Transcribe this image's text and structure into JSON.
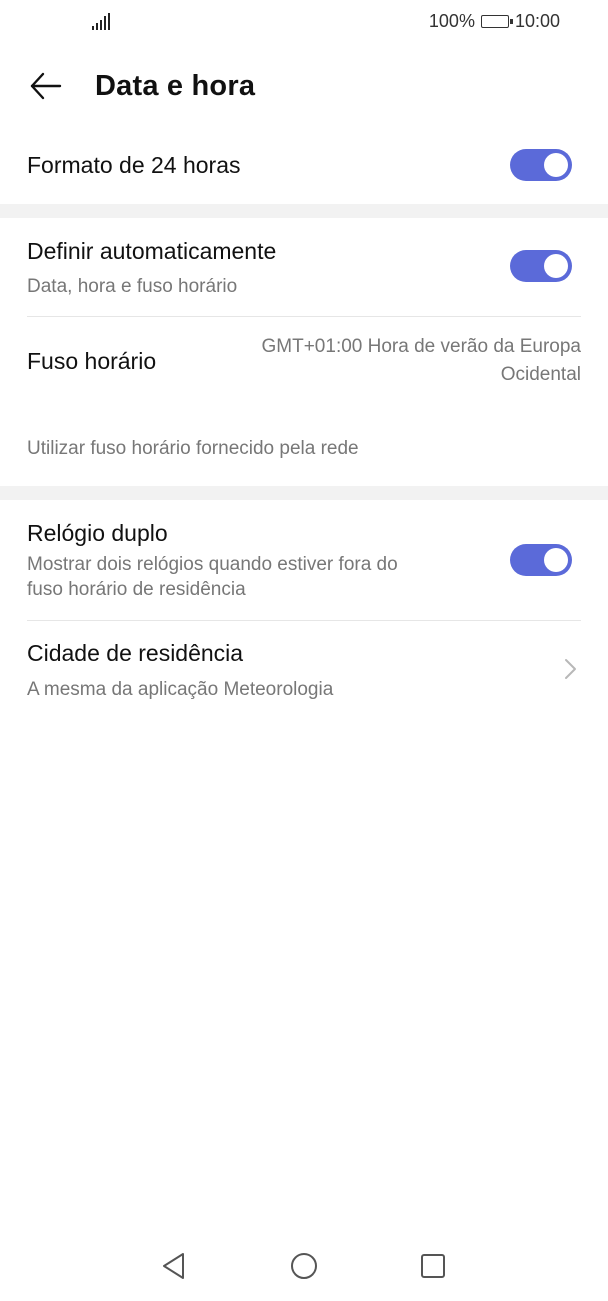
{
  "status": {
    "battery_text": "100%",
    "time": "10:00"
  },
  "header": {
    "title": "Data e hora"
  },
  "settings": {
    "format24": {
      "label": "Formato de 24 horas",
      "enabled": true
    },
    "auto": {
      "label": "Definir automaticamente",
      "sublabel": "Data, hora e fuso horário",
      "enabled": true
    },
    "timezone": {
      "label": "Fuso horário",
      "value_line1": "GMT+01:00 Hora de verão da Europa",
      "value_line2": "Ocidental"
    },
    "network_note": "Utilizar fuso horário fornecido pela rede",
    "dual_clock": {
      "label": "Relógio duplo",
      "sublabel_line1": "Mostrar dois relógios quando estiver fora do",
      "sublabel_line2": "fuso horário de residência",
      "enabled": true
    },
    "home_city": {
      "label": "Cidade de residência",
      "sublabel": "A mesma da aplicação Meteorologia"
    }
  },
  "colors": {
    "accent": "#5b6ad9",
    "section_gap": "#f2f2f2"
  }
}
